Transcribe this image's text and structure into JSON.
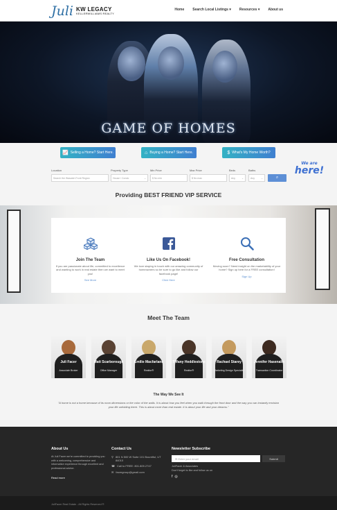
{
  "header": {
    "logo_script": "Juli",
    "logo_kw": "KW LEGACY",
    "logo_kw_sub": "KELLERWILLIAMS REALTY",
    "nav": [
      "Home",
      "Search Local Listings",
      "Resources",
      "About us"
    ]
  },
  "hero": {
    "title": "GAME OF HOMES"
  },
  "ctas": [
    {
      "label": "Selling a Home? Start Here.",
      "icon": "chart-icon"
    },
    {
      "label": "Buying a Home? Start Here.",
      "icon": "home-icon"
    },
    {
      "label": "What's My Home Worth?",
      "icon": "dollar-icon"
    }
  ],
  "search": {
    "location_label": "Location",
    "location_placeholder": "Search the Wasatch Front Region",
    "type_label": "Property Type",
    "type_value": "House / Condo",
    "min_label": "Min Price",
    "min_value": "$ No min",
    "max_label": "Max Price",
    "max_value": "$ No max",
    "beds_label": "Beds",
    "beds_value": "Any",
    "baths_label": "Baths",
    "baths_value": "Any",
    "button_icon": "search-icon"
  },
  "badge": {
    "line1": "We are",
    "line2": "here!"
  },
  "vip_heading": "Providing BEST FRIEND VIP SERVICE",
  "cards": [
    {
      "title": "Join The Team",
      "text": "If you are passionate about life, committed to excellence and wanting to work in real estate then we want to meet you!",
      "link": "See More",
      "icon": "cubes-icon"
    },
    {
      "title": "Like Us On Facebook!",
      "text": "We love staying in touch with our amazing community of homeowners so be sure to go like and follow our facebook page!",
      "link": "Click Here",
      "icon": "facebook-icon"
    },
    {
      "title": "Free Consultation",
      "text": "Moving soon? Need insight on the marketability of your home? Sign up here for a FREE consultation!",
      "link": "Sign Up",
      "icon": "magnifier-icon"
    }
  ],
  "team_heading": "Meet The Team",
  "team": [
    {
      "name": "Juli Facer",
      "role": "Associate Broker"
    },
    {
      "name": "Matt Scarborough",
      "role": "Office Manager"
    },
    {
      "name": "Emilie Macfarlane",
      "role": "Realtor®"
    },
    {
      "name": "Tiffany Heddlestone",
      "role": "Realtor®"
    },
    {
      "name": "Rachael Starey",
      "role": "Marketing Design Specialist"
    },
    {
      "name": "Jennifer Hasenalte",
      "role": "Transaction Coordinator"
    }
  ],
  "quote_heading": "The Way We See It",
  "quote": "\"A home is not a home because of its room dimensions or the color of the walls. It is about how you feel when you walk through the front door and the way you can instantly envision your life unfolding there. This is about more than real estate. It is about your life and your dreams.\"",
  "footer": {
    "about_title": "About Us",
    "about_text": "At Juli Facer we're committed to providing you with a welcoming, comprehensive and informative experience through excellent and professional advice.",
    "about_more": "Read more",
    "contact_title": "Contact Us",
    "address": "801 N 500 W Suite 101 Bountiful, UT 84010",
    "phone": "Call to FREE: 801.809.2747",
    "email": "facergroup@gmail.com",
    "news_title": "Newsletter Subscribe",
    "news_placeholder": "Enter your email",
    "news_button": "Submit",
    "news_text1": "JuliFacer & Associates",
    "news_text2": "Don't forget to like and follow us on"
  },
  "copyright": "JuliFacer Real Estate - All Rights Reserved ®"
}
